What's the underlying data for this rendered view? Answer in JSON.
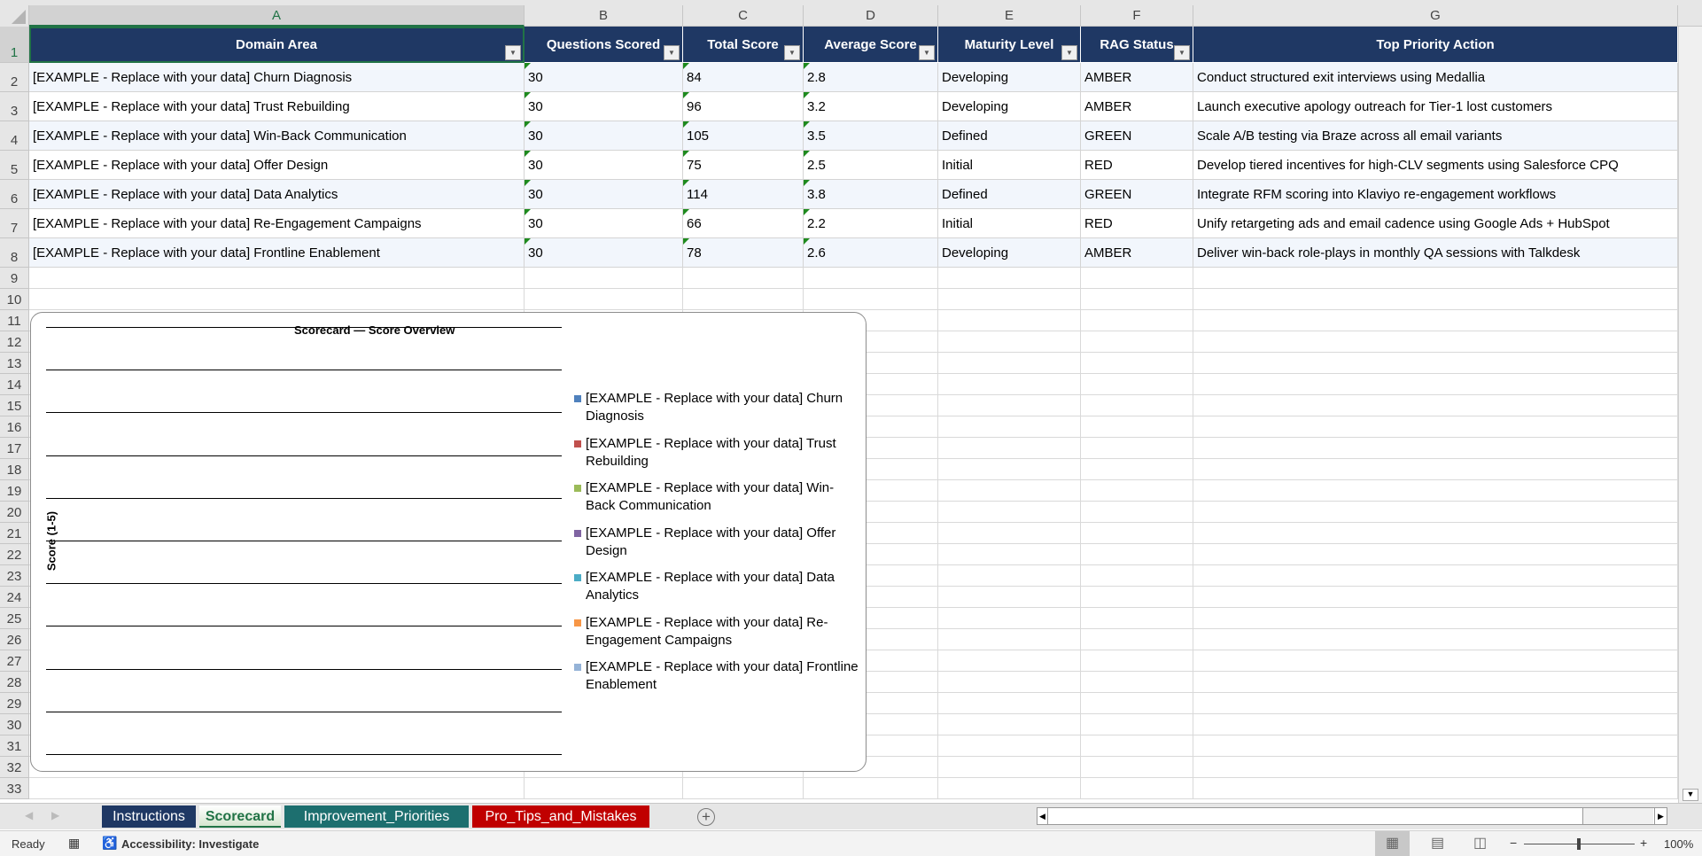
{
  "columns": [
    "A",
    "B",
    "C",
    "D",
    "E",
    "F",
    "G"
  ],
  "headers": [
    "Domain Area",
    "Questions Scored",
    "Total Score",
    "Average Score",
    "Maturity Level",
    "RAG Status",
    "Top Priority Action"
  ],
  "rows": [
    [
      "[EXAMPLE - Replace with your data] Churn Diagnosis",
      "30",
      "84",
      "2.8",
      "Developing",
      "AMBER",
      "Conduct structured exit interviews using Medallia"
    ],
    [
      "[EXAMPLE - Replace with your data] Trust Rebuilding",
      "30",
      "96",
      "3.2",
      "Developing",
      "AMBER",
      "Launch executive apology outreach for Tier-1 lost customers"
    ],
    [
      "[EXAMPLE - Replace with your data] Win-Back Communication",
      "30",
      "105",
      "3.5",
      "Defined",
      "GREEN",
      "Scale A/B testing via Braze across all email variants"
    ],
    [
      "[EXAMPLE - Replace with your data] Offer Design",
      "30",
      "75",
      "2.5",
      "Initial",
      "RED",
      "Develop tiered incentives for high-CLV segments using Salesforce CPQ"
    ],
    [
      "[EXAMPLE - Replace with your data] Data Analytics",
      "30",
      "114",
      "3.8",
      "Defined",
      "GREEN",
      "Integrate RFM scoring into Klaviyo re-engagement workflows"
    ],
    [
      "[EXAMPLE - Replace with your data] Re-Engagement Campaigns",
      "30",
      "66",
      "2.2",
      "Initial",
      "RED",
      "Unify retargeting ads and email cadence using Google Ads + HubSpot"
    ],
    [
      "[EXAMPLE - Replace with your data] Frontline Enablement",
      "30",
      "78",
      "2.6",
      "Developing",
      "AMBER",
      "Deliver win-back role-plays in monthly QA sessions with Talkdesk"
    ]
  ],
  "row_numbers": [
    "1",
    "2",
    "3",
    "4",
    "5",
    "6",
    "7",
    "8",
    "9",
    "10",
    "11",
    "12",
    "13",
    "14",
    "15",
    "16",
    "17",
    "18",
    "19",
    "20",
    "21",
    "22",
    "23",
    "24",
    "25",
    "26",
    "27",
    "28",
    "29",
    "30",
    "31",
    "32",
    "33"
  ],
  "chart_data": {
    "type": "bar",
    "title": "Scorecard — Score Overview",
    "ylabel": "Score (1-5)",
    "xlabel": "",
    "grid": true,
    "legend_position": "right",
    "legend": [
      "[EXAMPLE - Replace with your data] Churn Diagnosis",
      "[EXAMPLE - Replace with your data] Trust Rebuilding",
      "[EXAMPLE - Replace with your data] Win-Back Communication",
      "[EXAMPLE - Replace with your data] Offer Design",
      "[EXAMPLE - Replace with your data] Data Analytics",
      "[EXAMPLE - Replace with your data] Re-Engagement Campaigns",
      "[EXAMPLE - Replace with your data] Frontline Enablement"
    ],
    "colors": [
      "#4f81bd",
      "#c0504d",
      "#9bbb59",
      "#8064a2",
      "#4bacc6",
      "#f79646",
      "#95b3d7"
    ]
  },
  "sheet_tabs": [
    {
      "label": "Instructions",
      "color": "#1f3864",
      "active": false
    },
    {
      "label": "Scorecard",
      "color": "#e2efda",
      "active": true
    },
    {
      "label": "Improvement_Priorities",
      "color": "#1d6f6f",
      "active": false
    },
    {
      "label": "Pro_Tips_and_Mistakes",
      "color": "#c00000",
      "active": false
    }
  ],
  "status": {
    "ready": "Ready",
    "accessibility": "Accessibility: Investigate",
    "zoom": "100%"
  },
  "colors": {
    "header_bg": "#1f3864",
    "band": "#f2f6fc",
    "accent": "#217346"
  }
}
